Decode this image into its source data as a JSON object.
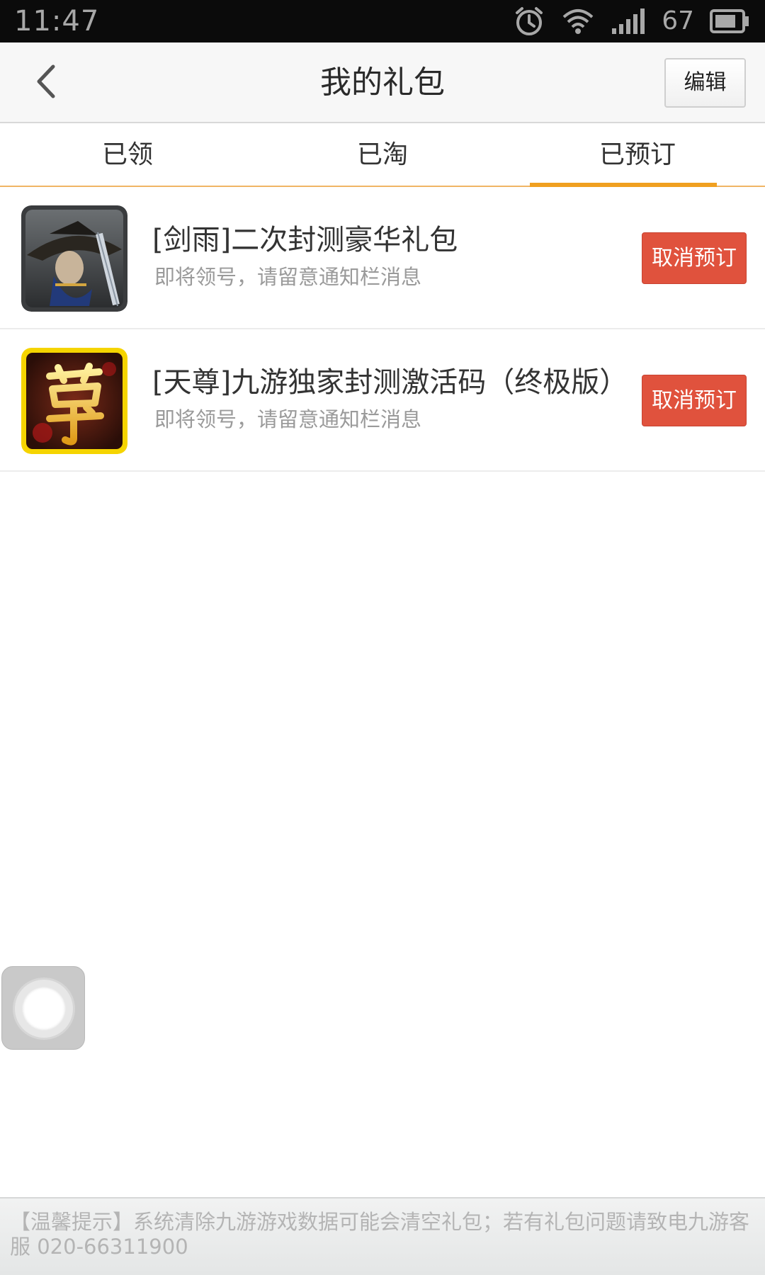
{
  "status_bar": {
    "time": "11:47",
    "battery": "67",
    "icons": [
      "alarm-icon",
      "wifi-icon",
      "signal-icon",
      "battery-icon"
    ]
  },
  "header": {
    "title": "我的礼包",
    "edit_label": "编辑",
    "back_icon": "back-arrow-icon"
  },
  "tabs": [
    {
      "label": "已领",
      "active": false
    },
    {
      "label": "已淘",
      "active": false
    },
    {
      "label": "已预订",
      "active": true
    }
  ],
  "gifts": [
    {
      "icon": "jianyu-game-icon",
      "title": "[剑雨]二次封测豪华礼包",
      "subtitle": "即将领号，请留意通知栏消息",
      "action_label": "取消预订"
    },
    {
      "icon": "tianzun-game-icon",
      "title": "[天尊]九游独家封测激活码（终极版）",
      "subtitle": "即将领号，请留意通知栏消息",
      "action_label": "取消预订"
    }
  ],
  "footer": {
    "tip": "【温馨提示】系统清除九游游戏数据可能会清空礼包；若有礼包问题请致电九游客服 020-66311900"
  },
  "colors": {
    "accent": "#f0a020",
    "cancel_button": "#e0523d",
    "status_bar": "#0b0b0b",
    "header_bg": "#f7f7f7"
  }
}
